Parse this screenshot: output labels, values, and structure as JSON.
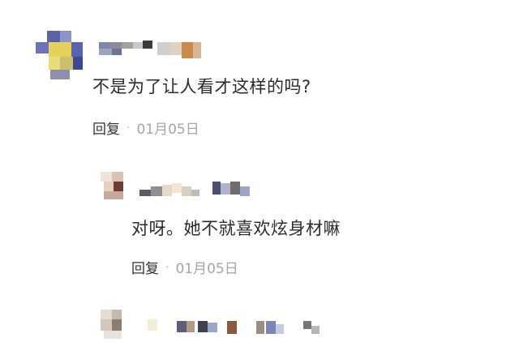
{
  "comments": [
    {
      "text": "不是为了让人看才这样的吗?",
      "reply_label": "回复",
      "separator": "·",
      "date": "01月05日",
      "avatar_colors": [
        "#3d4a8c",
        "#e8d75a",
        "#8aa0d8",
        "#6f7fc2"
      ]
    },
    {
      "text": "对呀。她不就喜欢炫身材嘛",
      "reply_label": "回复",
      "separator": "·",
      "date": "01月05日",
      "avatar_colors": [
        "#c9a99a",
        "#7a4a3a",
        "#e6d3c8"
      ]
    },
    {
      "avatar_colors": [
        "#cfc2b6",
        "#8a7a6e",
        "#e8e0d8"
      ]
    }
  ],
  "colors": {
    "text": "#2b2b2b",
    "reply": "#333333",
    "date": "#a6a6a6",
    "background": "#ffffff"
  }
}
